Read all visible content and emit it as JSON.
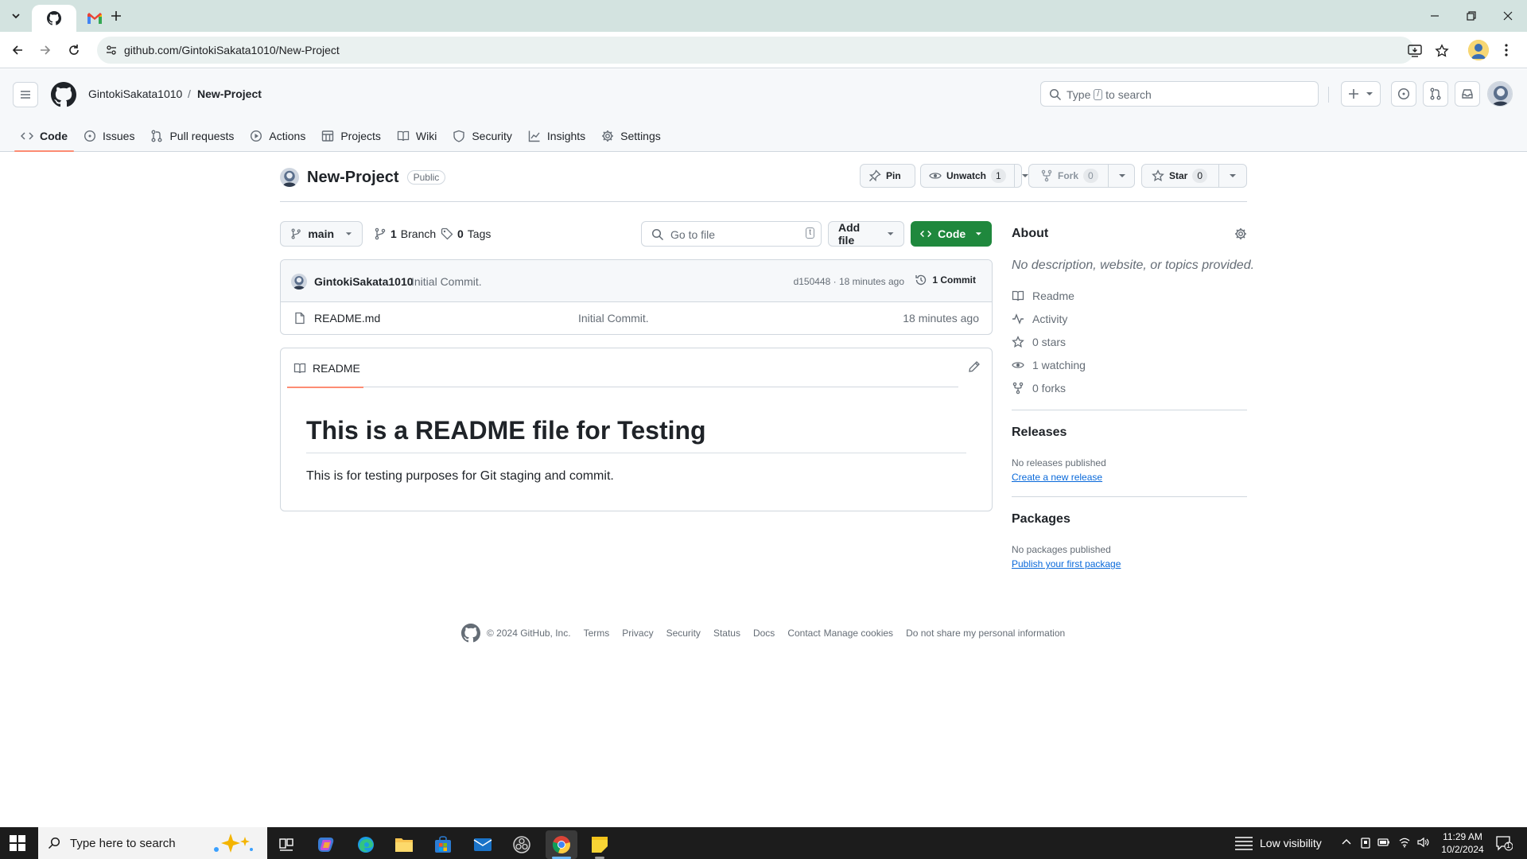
{
  "browser": {
    "tabs": [
      {
        "icon": "github-icon",
        "active": true
      },
      {
        "icon": "gmail-icon",
        "active": false
      }
    ],
    "url": "github.com/GintokiSakata1010/New-Project"
  },
  "header": {
    "owner": "GintokiSakata1010",
    "separator": "/",
    "repo": "New-Project",
    "search_prefix": "Type",
    "search_key": "/",
    "search_suffix": "to search"
  },
  "repo_nav": [
    {
      "label": "Code",
      "icon": "code-icon",
      "selected": true
    },
    {
      "label": "Issues",
      "icon": "issue-icon"
    },
    {
      "label": "Pull requests",
      "icon": "pull-request-icon"
    },
    {
      "label": "Actions",
      "icon": "play-icon"
    },
    {
      "label": "Projects",
      "icon": "table-icon"
    },
    {
      "label": "Wiki",
      "icon": "book-icon"
    },
    {
      "label": "Security",
      "icon": "shield-icon"
    },
    {
      "label": "Insights",
      "icon": "graph-icon"
    },
    {
      "label": "Settings",
      "icon": "gear-icon"
    }
  ],
  "repo": {
    "name": "New-Project",
    "visibility": "Public",
    "pin_label": "Pin",
    "watch_label": "Unwatch",
    "watch_count": "1",
    "fork_label": "Fork",
    "fork_count": "0",
    "star_label": "Star",
    "star_count": "0"
  },
  "browser_bar": {
    "branch": "main",
    "branches": "1",
    "branches_label": "Branch",
    "tags": "0",
    "tags_label": "Tags",
    "goto_placeholder": "Go to file",
    "goto_key": "t",
    "add_file_label": "Add file",
    "code_label": "Code"
  },
  "latest_commit": {
    "author": "GintokiSakata1010",
    "message": "Initial Commit.",
    "meta": "d150448 · 18 minutes ago",
    "count_label": "1 Commit"
  },
  "files": [
    {
      "name": "README.md",
      "message": "Initial Commit.",
      "time": "18 minutes ago"
    }
  ],
  "readme": {
    "tab_label": "README",
    "heading": "This is a README file for Testing",
    "paragraph": "This is for testing purposes for Git staging and commit."
  },
  "sidebar": {
    "about_title": "About",
    "description": "No description, website, or topics provided.",
    "items": [
      {
        "icon": "book-icon",
        "label": "Readme"
      },
      {
        "icon": "pulse-icon",
        "label": "Activity"
      },
      {
        "icon": "star-icon",
        "label": "0 stars"
      },
      {
        "icon": "eye-icon",
        "label": "1 watching"
      },
      {
        "icon": "fork-icon",
        "label": "0 forks"
      }
    ],
    "releases_title": "Releases",
    "releases_note": "No releases published",
    "releases_link": "Create a new release",
    "packages_title": "Packages",
    "packages_note": "No packages published",
    "packages_link": "Publish your first package"
  },
  "footer": {
    "copyright": "© 2024 GitHub, Inc.",
    "links": [
      "Terms",
      "Privacy",
      "Security",
      "Status",
      "Docs",
      "Contact",
      "Manage cookies",
      "Do not share my personal information"
    ]
  },
  "taskbar": {
    "search_placeholder": "Type here to search",
    "weather": "Low visibility",
    "time": "11:29 AM",
    "date": "10/2/2024",
    "notification_count": "1"
  },
  "colors": {
    "accent_green": "#1f883d",
    "link_blue": "#0969da",
    "tab_underline": "#fd8c73",
    "chrome_frame": "#d3e3e0"
  }
}
